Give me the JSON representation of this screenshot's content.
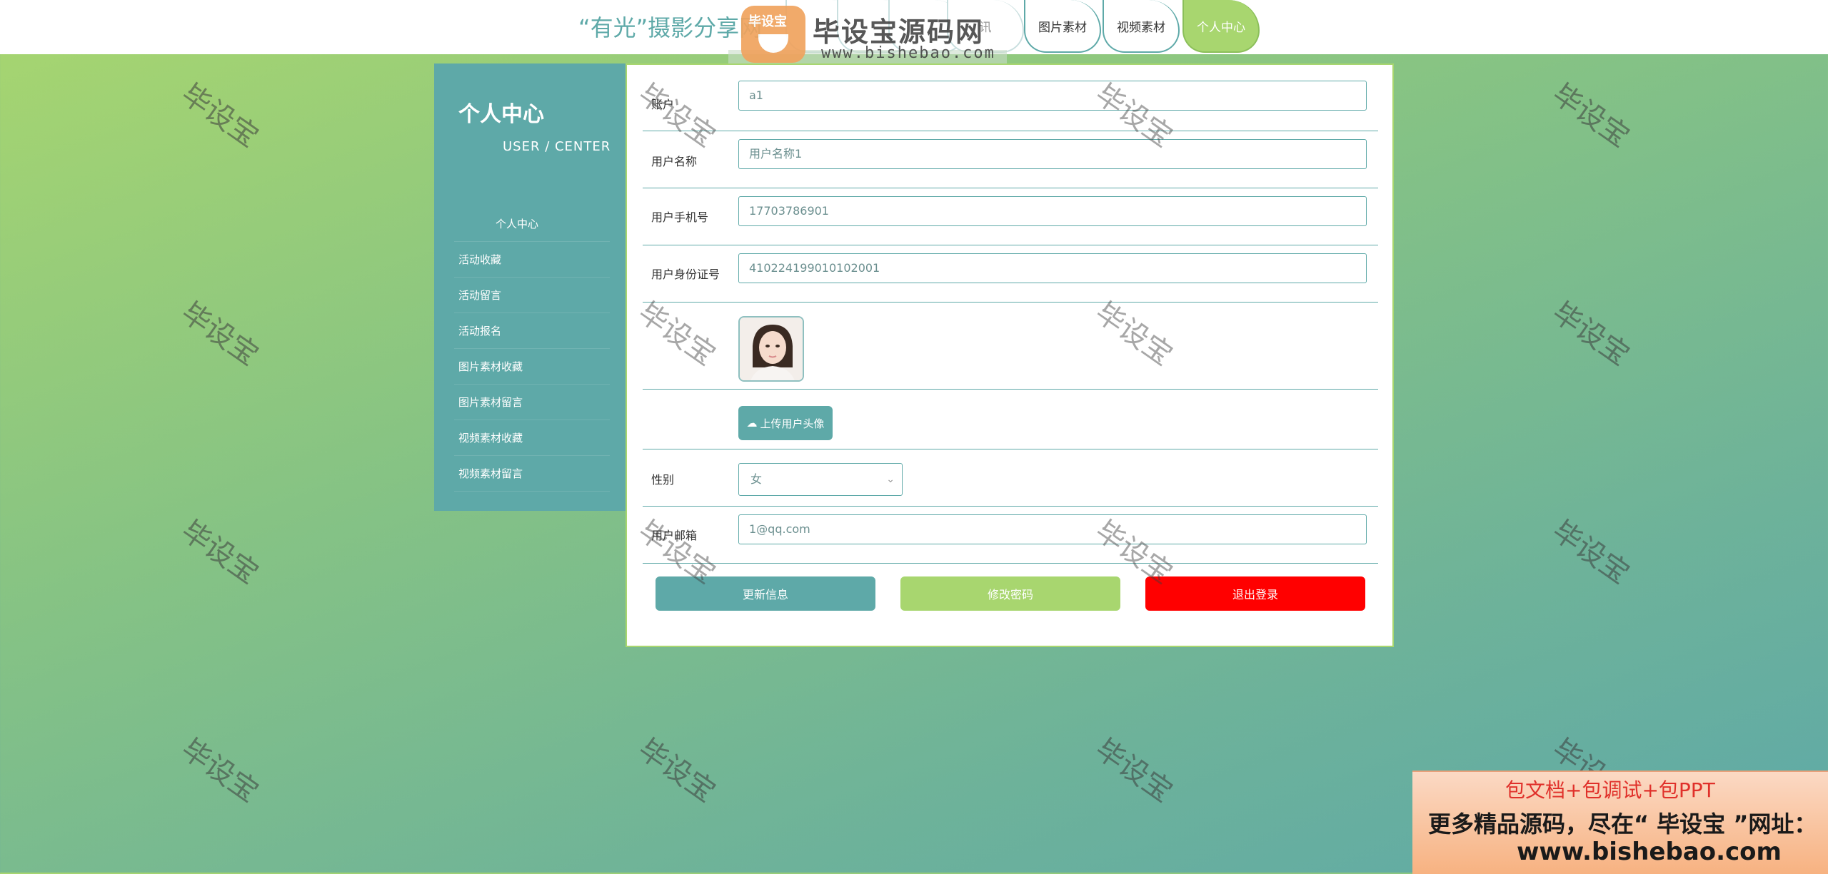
{
  "header": {
    "site_title": "“有光”摄影分享网",
    "nav": [
      {
        "label": ""
      },
      {
        "label": ""
      },
      {
        "label": ""
      },
      {
        "label": "讯"
      },
      {
        "label": "图片素材"
      },
      {
        "label": "视频素材"
      },
      {
        "label": "个人中心"
      }
    ]
  },
  "logo": {
    "badge_text": "毕设宝",
    "name": "毕设宝源码网",
    "url": "www.bishebao.com"
  },
  "sidebar": {
    "title": "个人中心",
    "subtitle": "USER / CENTER",
    "items": [
      {
        "label": "个人中心"
      },
      {
        "label": "活动收藏"
      },
      {
        "label": "活动留言"
      },
      {
        "label": "活动报名"
      },
      {
        "label": "图片素材收藏"
      },
      {
        "label": "图片素材留言"
      },
      {
        "label": "视频素材收藏"
      },
      {
        "label": "视频素材留言"
      }
    ]
  },
  "form": {
    "account_label": "账户",
    "account_value": "a1",
    "username_label": "用户名称",
    "username_placeholder": "用户名称1",
    "phone_label": "用户手机号",
    "phone_value": "17703786901",
    "idcard_label": "用户身份证号",
    "idcard_value": "410224199010102001",
    "upload_label": "上传用户头像",
    "gender_label": "性别",
    "gender_value": "女",
    "email_label": "用户邮箱",
    "email_value": "1@qq.com"
  },
  "buttons": {
    "update": "更新信息",
    "change_password": "修改密码",
    "logout": "退出登录"
  },
  "colors": {
    "primary": "#5ea9a8",
    "accent_green": "#a8d66f",
    "danger": "#ff0000"
  },
  "watermark": "毕设宝",
  "promo": {
    "line1": "包文档+包调试+包PPT",
    "line2": "更多精品源码，尽在“ 毕设宝 ”网址：",
    "line3": "www.bishebao.com"
  }
}
